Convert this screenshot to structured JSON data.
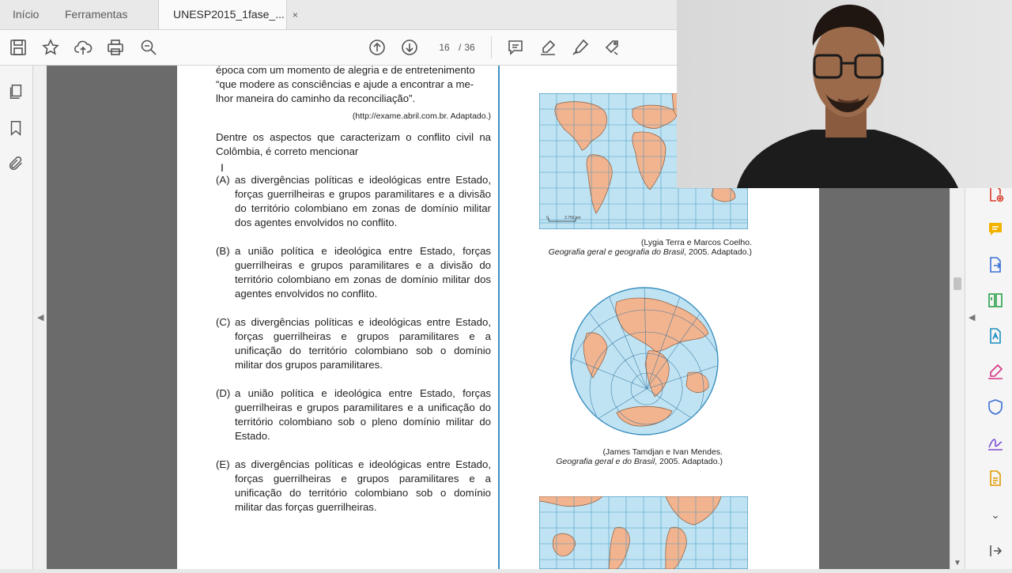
{
  "tabs": {
    "home": "Início",
    "tools": "Ferramentas",
    "document": "UNESP2015_1fase_...",
    "close_glyph": "×"
  },
  "toolbar": {
    "current_page": "16",
    "page_separator": "/",
    "total_pages": "36",
    "icons": [
      "save-icon",
      "star-icon",
      "upload-icon",
      "print-icon",
      "zoom-search-icon",
      "page-up-icon",
      "page-down-icon",
      "comment-icon",
      "highlight-pen-icon",
      "sign-icon",
      "stamp-icon"
    ]
  },
  "left_nav": {
    "icons": [
      "pages-icon",
      "bookmark-icon",
      "attachment-icon"
    ]
  },
  "document": {
    "intro_lines": [
      "época com um momento de alegria e de entretenimento",
      "“que modere as consciências e ajude a encontrar a me-",
      "lhor maneira do caminho da reconciliação”."
    ],
    "source": "(http://exame.abril.com.br. Adaptado.)",
    "question": "Dentre os aspectos que caracterizam o conflito civil na Colômbia, é correto mencionar",
    "options": [
      {
        "label": "(A)",
        "text": "as divergências políticas e ideológicas entre Estado, forças guerrilheiras e grupos paramilitares e a divisão do território colombiano em zonas de domínio militar dos agentes envolvidos no conflito."
      },
      {
        "label": "(B)",
        "text": "a união política e ideológica entre Estado, forças guerrilheiras e grupos paramilitares e a divisão do território colombiano em zonas de domínio militar dos agentes envolvidos no conflito."
      },
      {
        "label": "(C)",
        "text": "as divergências políticas e ideológicas entre Estado, forças guerrilheiras e grupos paramilitares e a unificação do território colombiano sob o domínio militar dos grupos paramilitares."
      },
      {
        "label": "(D)",
        "text": "a união política e ideológica entre Estado, forças guerrilheiras e grupos paramilitares e a unificação do território colombiano sob o pleno domínio militar do Estado."
      },
      {
        "label": "(E)",
        "text": "as divergências políticas e ideológicas entre Estado, forças guerrilheiras e grupos paramilitares e a unificação do território colombiano sob o domínio militar das forças guerrilheiras."
      }
    ],
    "map1": {
      "scale_zero": "0",
      "scale_label": "3.750 km",
      "credit_line1": "(Lygia Terra e Marcos Coelho.",
      "credit_line2_italic": "Geografia geral e geografia do Brasil",
      "credit_line2_rest": ", 2005. Adaptado.)"
    },
    "map2": {
      "credit_line1": "(James Tamdjan e Ivan Mendes.",
      "credit_line2_italic": "Geografia geral e do Brasil",
      "credit_line2_rest": ", 2005. Adaptado.)"
    }
  },
  "right_tools": {
    "icons": [
      "create-pdf-icon",
      "comment-tool-icon",
      "export-pdf-icon",
      "organize-pages-icon",
      "edit-pdf-icon",
      "fill-sign-icon",
      "protect-icon",
      "sign-tool-icon",
      "more-tools-icon"
    ]
  },
  "colors": {
    "accent_blue": "#3d8fc4",
    "map_water": "#bfe3f2",
    "map_land": "#f2b48f",
    "adobe_red": "#d83b2c"
  }
}
